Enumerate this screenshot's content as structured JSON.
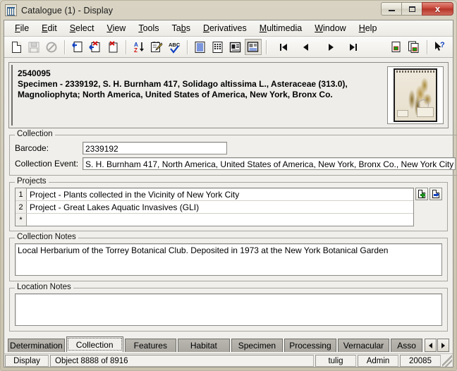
{
  "window": {
    "title": "Catalogue (1) - Display",
    "icon": "specimen-cabinet-icon",
    "minimize_label": "",
    "maximize_label": "",
    "close_label": "x"
  },
  "menubar": [
    {
      "label": "File",
      "accel": "F"
    },
    {
      "label": "Edit",
      "accel": "E"
    },
    {
      "label": "Select",
      "accel": "S"
    },
    {
      "label": "View",
      "accel": "V"
    },
    {
      "label": "Tools",
      "accel": "T"
    },
    {
      "label": "Tabs",
      "accel": "b"
    },
    {
      "label": "Derivatives",
      "accel": "D"
    },
    {
      "label": "Multimedia",
      "accel": "M"
    },
    {
      "label": "Window",
      "accel": "W"
    },
    {
      "label": "Help",
      "accel": "H"
    }
  ],
  "toolbar": {
    "buttons": [
      {
        "name": "new-record-icon",
        "enabled": true
      },
      {
        "name": "save-icon",
        "enabled": false
      },
      {
        "name": "cancel-icon",
        "enabled": false
      },
      {
        "name": "retrieve-record-icon",
        "enabled": true
      },
      {
        "name": "delete-record-icon",
        "enabled": true
      },
      {
        "name": "clear-record-icon",
        "enabled": true
      },
      {
        "name": "sort-az-icon",
        "enabled": true
      },
      {
        "name": "edit-note-icon",
        "enabled": true
      },
      {
        "name": "spell-check-icon",
        "enabled": true
      },
      {
        "name": "view-list-icon",
        "enabled": true
      },
      {
        "name": "view-grid-icon",
        "enabled": true
      },
      {
        "name": "view-card-icon",
        "enabled": true
      },
      {
        "name": "view-display-icon",
        "enabled": true
      },
      {
        "name": "first-record-icon",
        "enabled": true
      },
      {
        "name": "previous-record-icon",
        "enabled": true
      },
      {
        "name": "next-record-icon",
        "enabled": true
      },
      {
        "name": "last-record-icon",
        "enabled": true
      },
      {
        "name": "duplicate-record-icon",
        "enabled": true
      },
      {
        "name": "copy-records-icon",
        "enabled": true
      },
      {
        "name": "context-help-icon",
        "enabled": true
      }
    ]
  },
  "header": {
    "id": "2540095",
    "line1": "Specimen - 2339192, S. H. Burnham 417, Solidago altissima L., Asteraceae (313.0),",
    "line2": "Magnoliophyta;  North America, United States of America, New York, Bronx Co.",
    "thumbnail_alt": "herbarium-sheet-thumbnail"
  },
  "collection": {
    "legend": "Collection",
    "barcode_label": "Barcode:",
    "barcode_value": "2339192",
    "collection_event_label": "Collection Event:",
    "collection_event_value": "S. H. Burnham 417, North America, United States of America, New York, Bronx Co., New York City",
    "add_button": "add-collection-event",
    "goto_button": "goto-collection-event"
  },
  "projects": {
    "legend": "Projects",
    "rows": [
      {
        "num": "1",
        "value": "Project - Plants collected in the Vicinity of New York City"
      },
      {
        "num": "2",
        "value": "Project - Great Lakes Aquatic Invasives (GLI)"
      },
      {
        "num": "*",
        "value": ""
      }
    ],
    "add_button": "add-project",
    "goto_button": "goto-project"
  },
  "collection_notes": {
    "legend": "Collection Notes",
    "value": "Local Herbarium of the Torrey Botanical Club. Deposited in 1973 at the New York Botanical Garden"
  },
  "location_notes": {
    "legend": "Location Notes",
    "value": ""
  },
  "tabs": {
    "items": [
      {
        "label": "Determination",
        "active": false
      },
      {
        "label": "Collection",
        "active": true
      },
      {
        "label": "Features",
        "active": false
      },
      {
        "label": "Habitat",
        "active": false
      },
      {
        "label": "Specimen",
        "active": false
      },
      {
        "label": "Processing",
        "active": false
      },
      {
        "label": "Vernacular",
        "active": false
      },
      {
        "label": "Asso",
        "active": false
      }
    ],
    "scroll_left": "scroll-tabs-left",
    "scroll_right": "scroll-tabs-right"
  },
  "statusbar": {
    "mode": "Display",
    "record": "Object 8888 of 8916",
    "user": "tulig",
    "role": "Admin",
    "code": "20085"
  },
  "colors": {
    "window_frame": "#d6d2c2",
    "client_bg": "#f0efeb",
    "close_button": "#c8473a",
    "tab_inactive": "#b0aea7",
    "field_bg": "#ffffff",
    "accent_blue": "#1040c0",
    "accent_green": "#1a8a1a"
  }
}
